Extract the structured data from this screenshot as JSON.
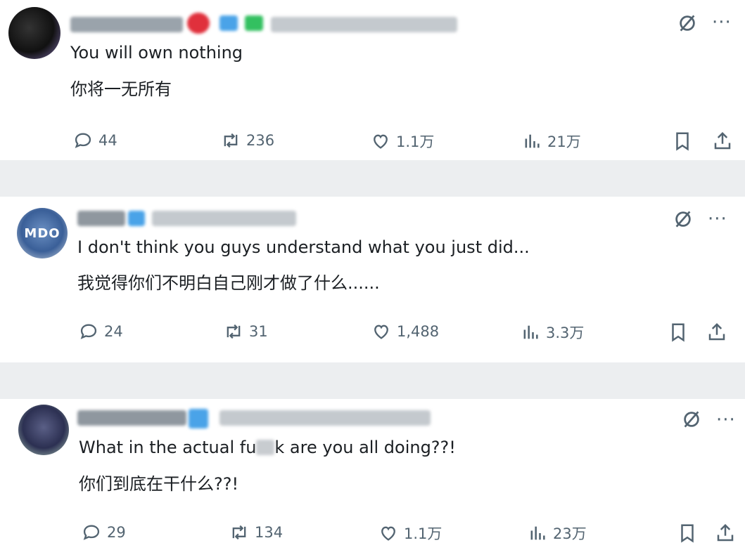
{
  "posts": [
    {
      "text_en": "You will own nothing",
      "text_zh": "你将一无所有",
      "replies": "44",
      "reposts": "236",
      "likes": "1.1万",
      "views": "21万"
    },
    {
      "text_en": "I don't think you guys understand what you just did...",
      "text_zh": "我觉得你们不明白自己刚才做了什么......",
      "replies": "24",
      "reposts": "31",
      "likes": "1,488",
      "views": "3.3万"
    },
    {
      "text_en_a": "What in the actual fu",
      "text_en_b": "k are you all doing??!",
      "text_zh": "你们到底在干什么??!",
      "replies": "29",
      "reposts": "134",
      "likes": "1.1万",
      "views": "23万"
    }
  ],
  "avatar_badge": "MDO",
  "more_label": "···",
  "colors": {
    "icon": "#536471",
    "text": "#0f1419",
    "divider": "#eceef0"
  },
  "icons": [
    "reply-icon",
    "repost-icon",
    "like-icon",
    "views-icon",
    "bookmark-icon",
    "share-icon",
    "grok-icon"
  ]
}
